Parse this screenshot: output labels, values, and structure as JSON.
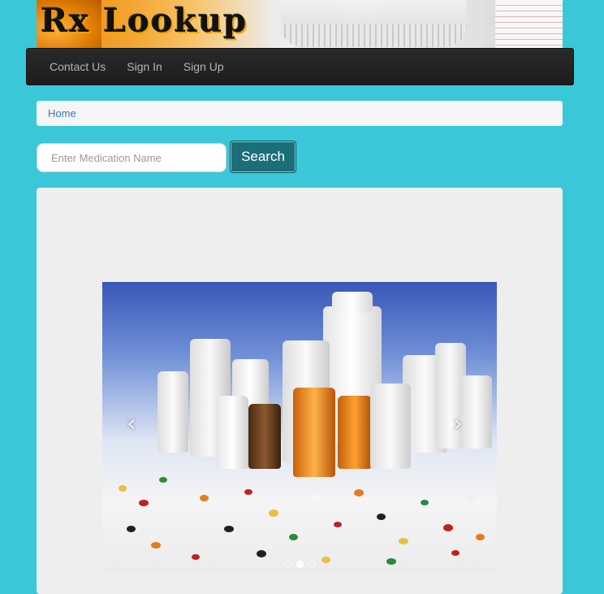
{
  "header": {
    "logo_text": "Rx Lookup"
  },
  "navbar": {
    "items": [
      {
        "label": "Contact Us"
      },
      {
        "label": "Sign In"
      },
      {
        "label": "Sign Up"
      }
    ]
  },
  "breadcrumb": {
    "home": "Home"
  },
  "search": {
    "placeholder": "Enter Medication Name",
    "value": "",
    "button_label": "Search"
  },
  "carousel": {
    "prev_symbol": "‹",
    "next_symbol": "›",
    "image_description_icon": "medication-bottles-image",
    "slide_count": 3,
    "active_slide": 1
  },
  "colors": {
    "page_background": "#3ac8d8",
    "navbar": "#222222",
    "search_button": "#1b6f78",
    "link": "#3b73b9"
  }
}
